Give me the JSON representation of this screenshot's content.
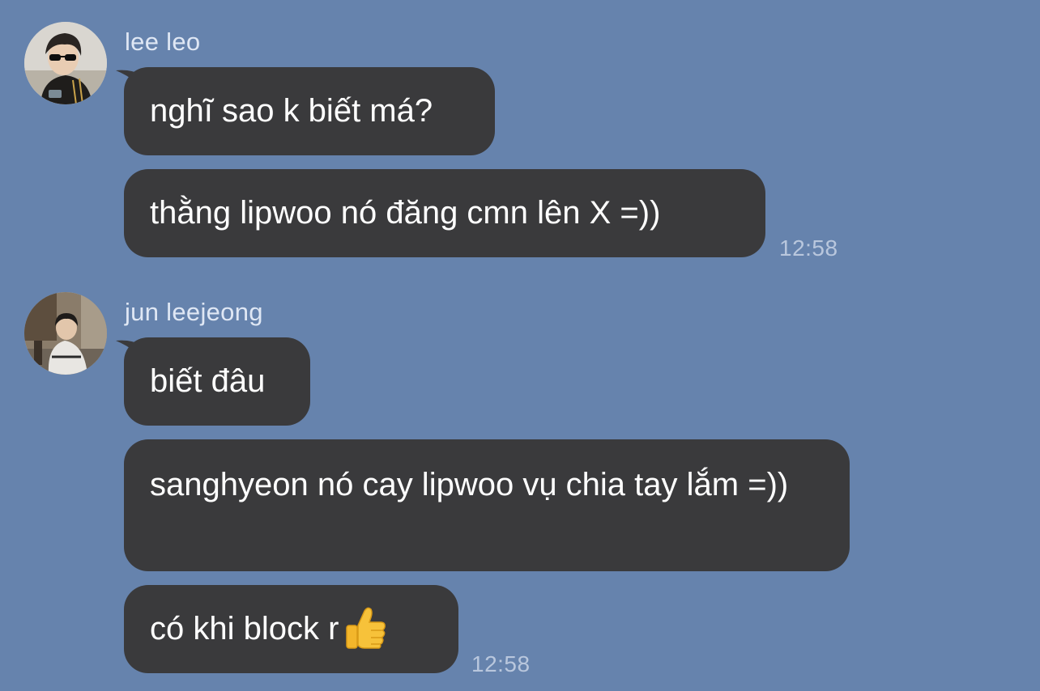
{
  "conversation": {
    "groups": [
      {
        "sender": "lee leo",
        "avatar_icon": "user-photo-lee-leo",
        "messages": [
          "nghĩ sao k biết má?",
          "thằng lipwoo nó đăng cmn lên X =))"
        ],
        "time": "12:58"
      },
      {
        "sender": "jun leejeong",
        "avatar_icon": "user-photo-jun-leejeong",
        "messages": [
          "biết đâu",
          "sanghyeon nó cay lipwoo vụ chia tay lắm =))",
          "có khi block r"
        ],
        "emoji_icon": "thumbs-up-icon",
        "time": "12:58"
      }
    ]
  },
  "colors": {
    "background": "#6683ad",
    "bubble": "#3a3a3c",
    "bubble_text": "#ffffff",
    "sender_name": "#dfe7f4",
    "timestamp": "#b9c7dd"
  }
}
